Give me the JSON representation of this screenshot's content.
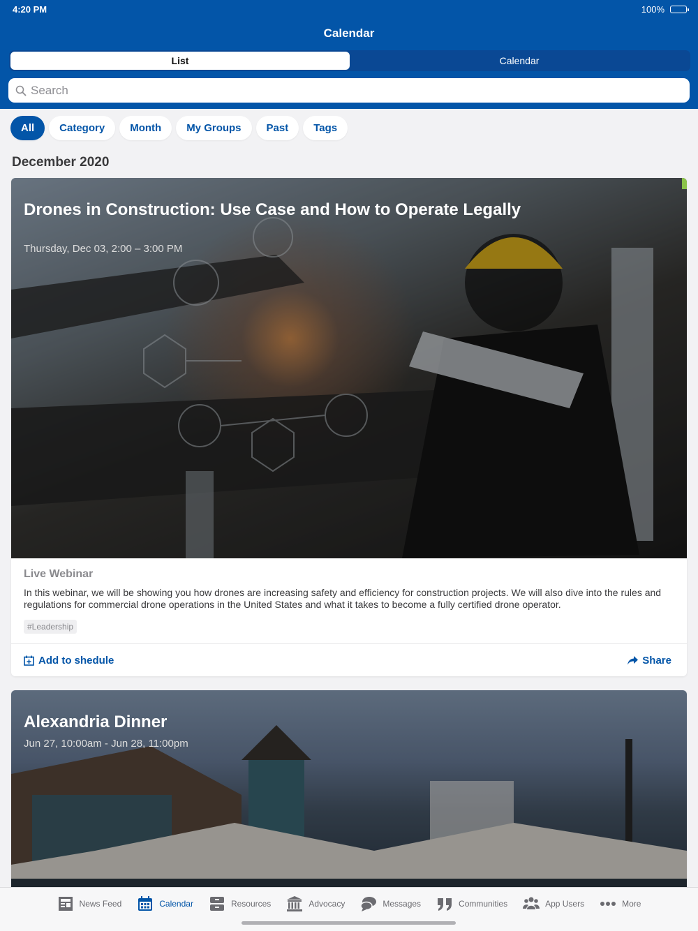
{
  "status": {
    "time": "4:20 PM",
    "battery": "100%"
  },
  "nav": {
    "title": "Calendar"
  },
  "segments": [
    {
      "label": "List",
      "active": true
    },
    {
      "label": "Calendar",
      "active": false
    }
  ],
  "search": {
    "placeholder": "Search",
    "value": ""
  },
  "filters": [
    {
      "label": "All",
      "active": true
    },
    {
      "label": "Category"
    },
    {
      "label": "Month"
    },
    {
      "label": "My Groups"
    },
    {
      "label": "Past"
    },
    {
      "label": "Tags"
    }
  ],
  "section": {
    "title": "December 2020"
  },
  "events": [
    {
      "title": "Drones in Construction: Use Case and How to Operate Legally",
      "date": "Thursday, Dec 03, 2:00 – 3:00 PM",
      "type": "Live Webinar",
      "description": "In this webinar, we will be showing you how drones are increasing safety and efficiency for construction projects. We will also dive into the rules and regulations for commercial drone operations in the United States and what it takes to become a fully certified drone operator.",
      "tag": "#Leadership",
      "add_label": "Add to shedule",
      "share_label": "Share"
    },
    {
      "title": "Alexandria Dinner",
      "date": "Jun 27, 10:00am - Jun 28, 11:00pm"
    }
  ],
  "tabbar": [
    {
      "label": "News Feed",
      "icon": "news-feed-icon"
    },
    {
      "label": "Calendar",
      "icon": "calendar-icon",
      "active": true
    },
    {
      "label": "Resources",
      "icon": "resources-icon"
    },
    {
      "label": "Advocacy",
      "icon": "advocacy-icon"
    },
    {
      "label": "Messages",
      "icon": "messages-icon"
    },
    {
      "label": "Communities",
      "icon": "communities-icon"
    },
    {
      "label": "App Users",
      "icon": "app-users-icon"
    },
    {
      "label": "More",
      "icon": "more-icon"
    }
  ],
  "colors": {
    "primary": "#0355a8",
    "accent": "#8bc34a",
    "background": "#f2f2f4"
  }
}
